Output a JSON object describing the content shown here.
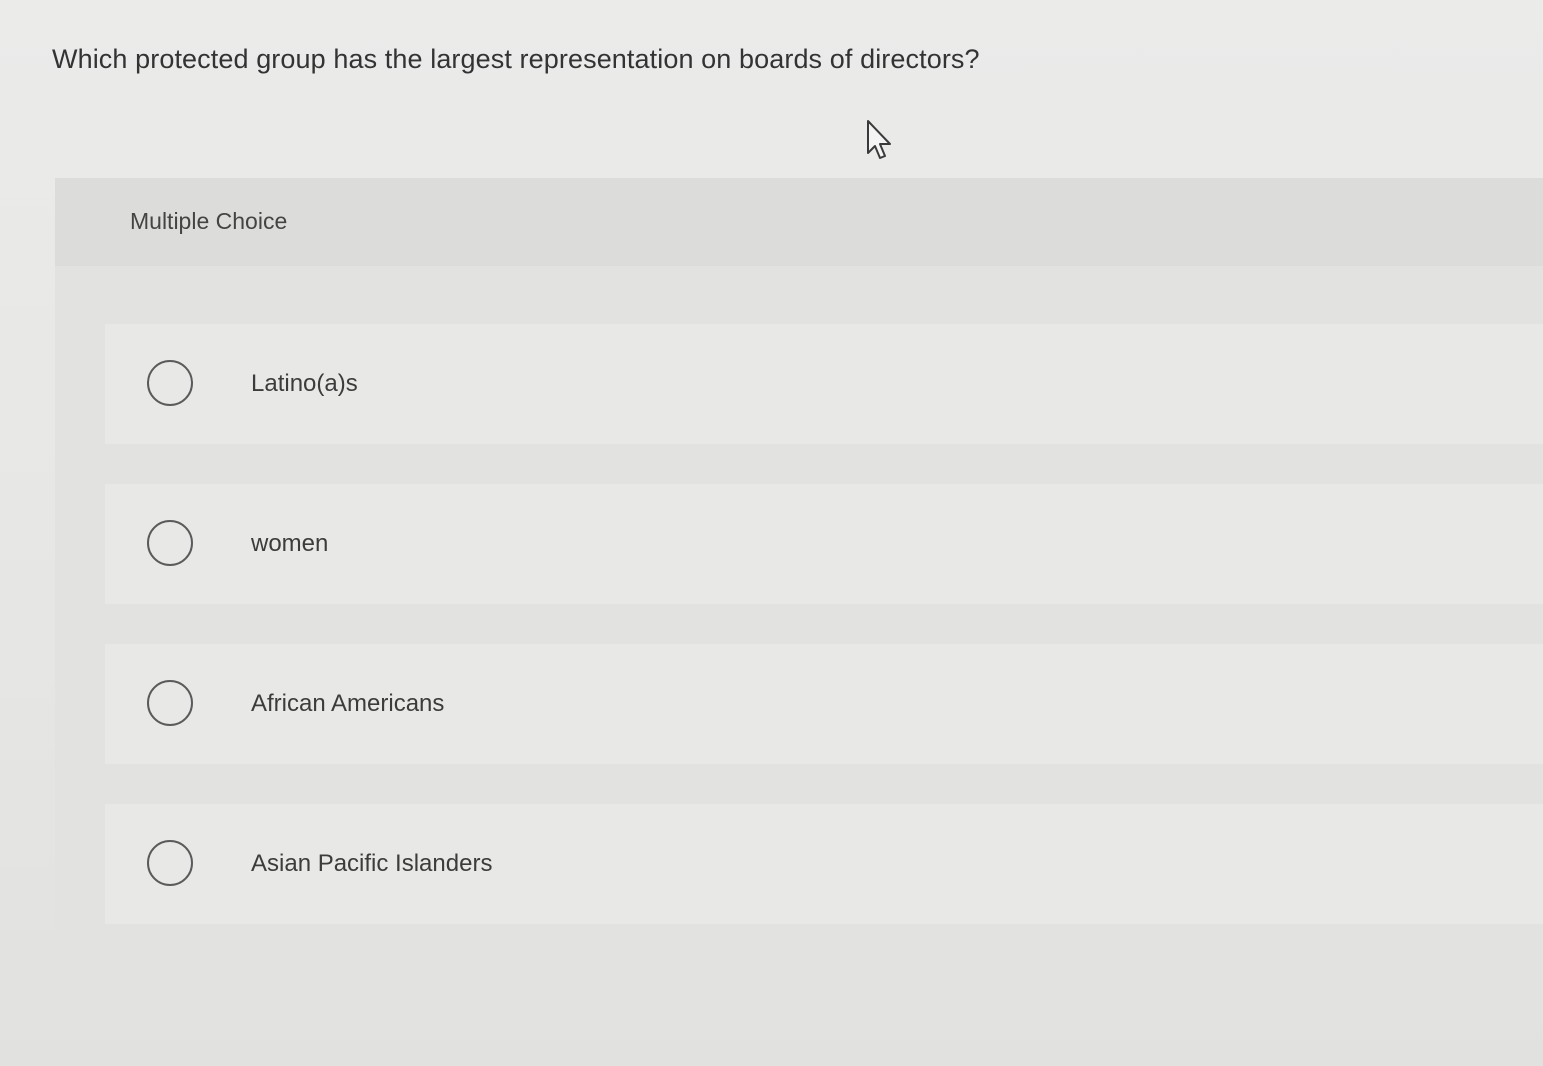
{
  "question": {
    "text": "Which protected group has the largest representation on boards of directors?"
  },
  "panel": {
    "type_label": "Multiple Choice"
  },
  "options": [
    {
      "label": "Latino(a)s",
      "selected": false
    },
    {
      "label": "women",
      "selected": false
    },
    {
      "label": "African Americans",
      "selected": false
    },
    {
      "label": "Asian Pacific Islanders",
      "selected": false
    }
  ],
  "icons": {
    "pointer": "mouse-pointer-icon",
    "radio": "radio-unselected-icon"
  },
  "colors": {
    "background": "#e8e8e6",
    "header": "#dcdcda",
    "radio_border": "#5a5a5a",
    "text": "#333333"
  }
}
